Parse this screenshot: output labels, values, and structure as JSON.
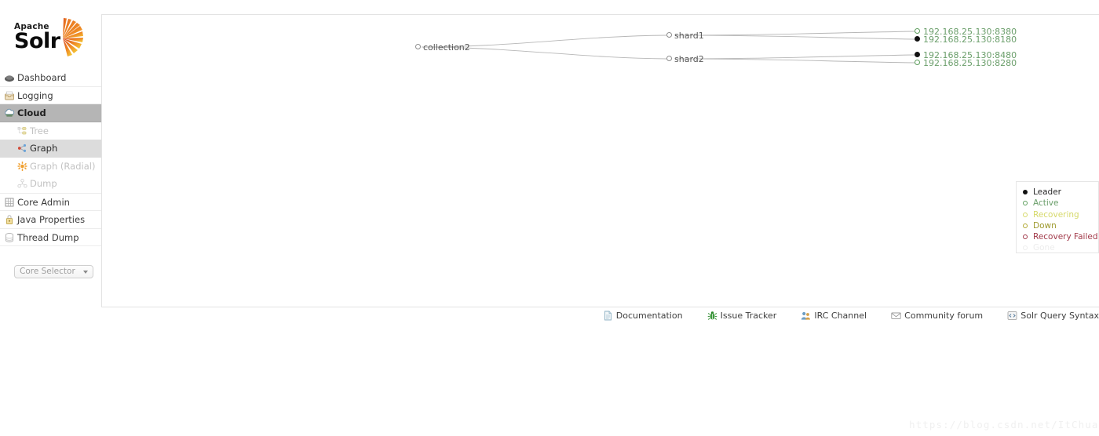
{
  "logo": {
    "apache": "Apache",
    "solr": "Solr",
    "mark_icon": "solr-sunburst-logo"
  },
  "sidebar": {
    "items": [
      {
        "label": "Dashboard",
        "icon": "dashboard-icon",
        "state": "normal"
      },
      {
        "label": "Logging",
        "icon": "logging-icon",
        "state": "normal"
      },
      {
        "label": "Cloud",
        "icon": "cloud-icon",
        "state": "selected"
      }
    ],
    "sub_items": [
      {
        "label": "Tree",
        "icon": "tree-icon",
        "state": "disabled"
      },
      {
        "label": "Graph",
        "icon": "graph-icon",
        "state": "active"
      },
      {
        "label": "Graph (Radial)",
        "icon": "graph-radial-icon",
        "state": "disabled"
      },
      {
        "label": "Dump",
        "icon": "dump-icon",
        "state": "disabled"
      }
    ],
    "items_bottom": [
      {
        "label": "Core Admin",
        "icon": "core-admin-icon",
        "state": "normal"
      },
      {
        "label": "Java Properties",
        "icon": "java-properties-icon",
        "state": "normal"
      },
      {
        "label": "Thread Dump",
        "icon": "thread-dump-icon",
        "state": "normal"
      }
    ],
    "core_selector": {
      "placeholder": "Core Selector",
      "value": "Core Selector",
      "caret_icon": "chevron-down-icon"
    }
  },
  "graph": {
    "collection": {
      "label": "collection2",
      "status": "active",
      "marker": "hollow-gray"
    },
    "shards": [
      {
        "label": "shard1",
        "status": "active",
        "marker": "hollow-gray"
      },
      {
        "label": "shard2",
        "status": "active",
        "marker": "hollow-gray"
      }
    ],
    "replicas": [
      {
        "label": "192.168.25.130:8380",
        "shard": "shard1",
        "status": "active",
        "marker": "hollow-green"
      },
      {
        "label": "192.168.25.130:8180",
        "shard": "shard1",
        "status": "leader",
        "marker": "filled-black"
      },
      {
        "label": "192.168.25.130:8480",
        "shard": "shard2",
        "status": "leader",
        "marker": "filled-black"
      },
      {
        "label": "192.168.25.130:8280",
        "shard": "shard2",
        "status": "active",
        "marker": "hollow-green"
      }
    ]
  },
  "legend": {
    "rows": [
      {
        "label": "Leader",
        "color": "#111111",
        "text_color": "#2b2b2b",
        "filled": true
      },
      {
        "label": "Active",
        "color": "#5d9e5d",
        "text_color": "#6a9e6a",
        "filled": false
      },
      {
        "label": "Recovering",
        "color": "#d6d96a",
        "text_color": "#d6d96a",
        "filled": false
      },
      {
        "label": "Down",
        "color": "#b0a830",
        "text_color": "#9e9a2e",
        "filled": false
      },
      {
        "label": "Recovery Failed",
        "color": "#a23a4a",
        "text_color": "#a23a4a",
        "filled": false
      },
      {
        "label": "Gone",
        "color": "#ededed",
        "text_color": "#ededed",
        "filled": false
      }
    ]
  },
  "footer": {
    "links": [
      {
        "label": "Documentation",
        "icon": "document-icon"
      },
      {
        "label": "Issue Tracker",
        "icon": "bug-icon"
      },
      {
        "label": "IRC Channel",
        "icon": "people-icon"
      },
      {
        "label": "Community forum",
        "icon": "envelope-icon"
      },
      {
        "label": "Solr Query Syntax",
        "icon": "code-icon"
      }
    ]
  },
  "watermark": {
    "text": "https://blog.csdn.net/ItChuangyi"
  }
}
